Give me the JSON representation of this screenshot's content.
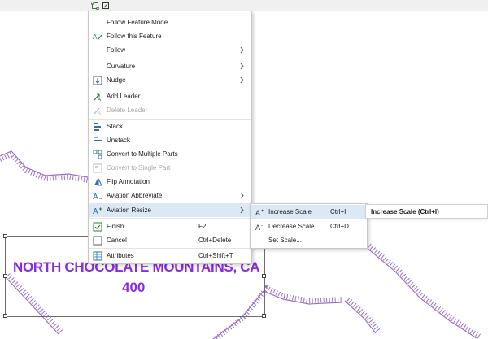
{
  "toolbar": {
    "items": [
      {
        "icon": "select-vertices-icon"
      },
      {
        "icon": "reshape-icon"
      }
    ]
  },
  "annotation": {
    "line1": "NORTH CHOCOLATE MOUNTAINS, CA",
    "line2": "400",
    "color": "#8a2be2"
  },
  "context_menu": {
    "items": [
      {
        "label": "Follow Feature Mode",
        "icon": "",
        "enabled": true
      },
      {
        "label": "Follow this Feature",
        "icon": "follow-feature-icon",
        "enabled": true
      },
      {
        "label": "Follow",
        "icon": "",
        "enabled": true,
        "submenu": true
      },
      {
        "label": "Curvature",
        "icon": "",
        "enabled": true,
        "submenu": true
      },
      {
        "label": "Nudge",
        "icon": "nudge-icon",
        "enabled": true,
        "submenu": true
      },
      {
        "label": "Add Leader",
        "icon": "add-leader-icon",
        "enabled": true
      },
      {
        "label": "Delete Leader",
        "icon": "delete-leader-icon",
        "enabled": false
      },
      {
        "label": "Stack",
        "icon": "stack-icon",
        "enabled": true
      },
      {
        "label": "Unstack",
        "icon": "unstack-icon",
        "enabled": true
      },
      {
        "label": "Convert to Multiple Parts",
        "icon": "convert-multiple-parts-icon",
        "enabled": true
      },
      {
        "label": "Convert to Single Part",
        "icon": "convert-single-part-icon",
        "enabled": false
      },
      {
        "label": "Flip Annotation",
        "icon": "flip-annotation-icon",
        "enabled": true
      },
      {
        "label": "Aviation Abbreviate",
        "icon": "aviation-abbreviate-icon",
        "enabled": true,
        "submenu": true
      },
      {
        "label": "Aviation Resize",
        "icon": "aviation-resize-icon",
        "enabled": true,
        "submenu": true,
        "highlighted": true
      },
      {
        "label": "Finish",
        "icon": "finish-icon",
        "shortcut": "F2",
        "enabled": true
      },
      {
        "label": "Cancel",
        "icon": "cancel-icon",
        "shortcut": "Ctrl+Delete",
        "enabled": true
      },
      {
        "label": "Attributes",
        "icon": "attributes-icon",
        "shortcut": "Ctrl+Shift+T",
        "enabled": true
      }
    ]
  },
  "submenu": {
    "items": [
      {
        "label": "Increase Scale",
        "icon": "increase-scale-icon",
        "shortcut": "Ctrl+I",
        "highlighted": true
      },
      {
        "label": "Decrease Scale",
        "icon": "decrease-scale-icon",
        "shortcut": "Ctrl+D"
      },
      {
        "label": "Set Scale...",
        "icon": ""
      }
    ]
  },
  "tooltip": {
    "text": "Increase Scale (Ctrl+I)"
  }
}
